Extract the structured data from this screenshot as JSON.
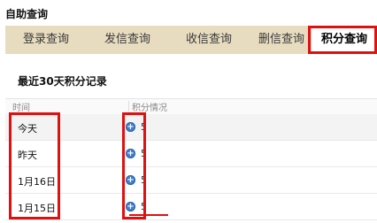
{
  "page": {
    "title": "自助查询"
  },
  "tabs": [
    {
      "label": "登录查询",
      "active": false
    },
    {
      "label": "发信查询",
      "active": false
    },
    {
      "label": "收信查询",
      "active": false
    },
    {
      "label": "删信查询",
      "active": false
    },
    {
      "label": "积分查询",
      "active": true
    }
  ],
  "section": {
    "title": "最近30天积分记录"
  },
  "table": {
    "columns": [
      "时间",
      "积分情况"
    ],
    "rows": [
      {
        "date": "今天",
        "points": "5"
      },
      {
        "date": "昨天",
        "points": "5"
      },
      {
        "date": "1月16日",
        "points": "5"
      },
      {
        "date": "1月15日",
        "points": "5"
      }
    ]
  },
  "icons": {
    "points_icon": "plus-circle-icon"
  },
  "colors": {
    "tab_bar_bg": "#e8dcc0",
    "highlight_red": "#e01010",
    "icon_blue": "#3f7fce"
  }
}
